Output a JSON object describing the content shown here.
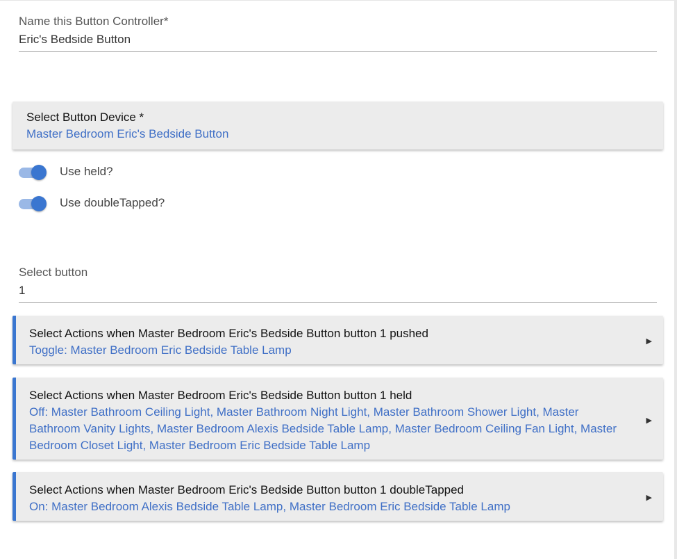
{
  "name_field": {
    "label": "Name this Button Controller*",
    "value": "Eric's Bedside Button"
  },
  "device_select": {
    "label": "Select Button Device *",
    "value": "Master Bedroom Eric's Bedside Button"
  },
  "toggles": [
    {
      "label": "Use held?",
      "on": true
    },
    {
      "label": "Use doubleTapped?",
      "on": true
    }
  ],
  "button_select": {
    "label": "Select button",
    "value": "1"
  },
  "actions": [
    {
      "title": "Select Actions when Master Bedroom Eric's Bedside Button button 1 pushed",
      "value": "Toggle: Master Bedroom Eric Bedside Table Lamp"
    },
    {
      "title": "Select Actions when Master Bedroom Eric's Bedside Button button 1 held",
      "value": "Off: Master Bathroom Ceiling Light, Master Bathroom Night Light, Master Bathroom Shower Light, Master Bathroom Vanity Lights, Master Bedroom Alexis Bedside Table Lamp, Master Bedroom Ceiling Fan Light, Master Bedroom Closet Light, Master Bedroom Eric Bedside Table Lamp"
    },
    {
      "title": "Select Actions when Master Bedroom Eric's Bedside Button button 1 doubleTapped",
      "value": "On: Master Bedroom Alexis Bedside Table Lamp, Master Bedroom Eric Bedside Table Lamp"
    }
  ],
  "colors": {
    "accent": "#3a76d0",
    "link": "#3f6fc6",
    "card_bg": "#ececec"
  },
  "icons": {
    "expand": "triangle-right-icon"
  }
}
